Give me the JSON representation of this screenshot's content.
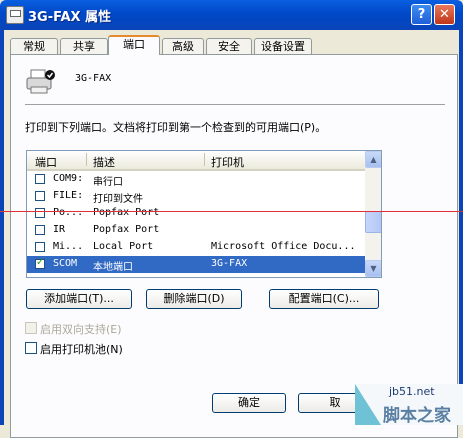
{
  "window": {
    "title": "3G-FAX 属性",
    "help_label": "?",
    "close_label": "✕"
  },
  "tabs": [
    {
      "label": "常规",
      "active": false
    },
    {
      "label": "共享",
      "active": false
    },
    {
      "label": "端口",
      "active": true
    },
    {
      "label": "高级",
      "active": false
    },
    {
      "label": "安全",
      "active": false
    },
    {
      "label": "设备设置",
      "active": false
    }
  ],
  "printer": {
    "name": "3G-FAX",
    "icon": "printer-icon"
  },
  "description": "打印到下列端口。文档将打印到第一个检查到的可用端口(P)。",
  "ports": {
    "columns": [
      "端口",
      "描述",
      "打印机"
    ],
    "rows": [
      {
        "port": "COM9:",
        "desc": "串行口",
        "printer": "",
        "checked": false,
        "selected": false
      },
      {
        "port": "FILE:",
        "desc": "打印到文件",
        "printer": "",
        "checked": false,
        "selected": false
      },
      {
        "port": "Po...",
        "desc": "Popfax Port",
        "printer": "",
        "checked": false,
        "selected": false
      },
      {
        "port": "IR",
        "desc": "Popfax Port",
        "printer": "",
        "checked": false,
        "selected": false
      },
      {
        "port": "Mi...",
        "desc": "Local Port",
        "printer": "Microsoft Office Docu...",
        "checked": false,
        "selected": false
      },
      {
        "port": "SCOM",
        "desc": "本地端口",
        "printer": "3G-FAX",
        "checked": true,
        "selected": true
      }
    ]
  },
  "buttons": {
    "add_port": "添加端口(T)...",
    "delete_port": "删除端口(D)",
    "config_port": "配置端口(C)...",
    "ok": "确定",
    "cancel": "取"
  },
  "options": {
    "bidirectional": "启用双向支持(E)",
    "pooling": "启用打印机池(N)"
  },
  "watermark": {
    "domain": "jb51.net",
    "site": "脚本之家"
  },
  "colors": {
    "title_bar": "#0048C8",
    "selection": "#316AC5",
    "tab_accent": "#E68B2C",
    "dialog_bg": "#ECE9D8"
  }
}
